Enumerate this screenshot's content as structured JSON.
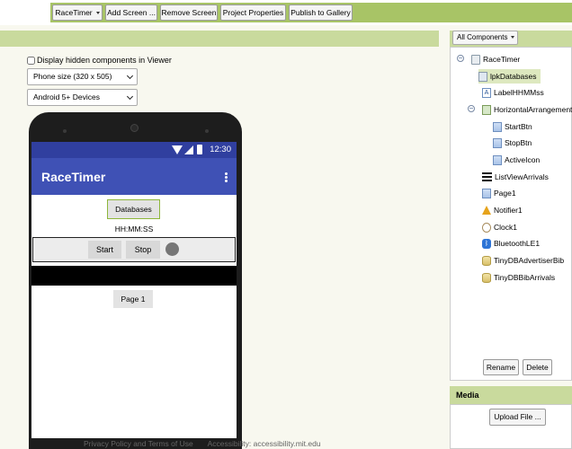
{
  "toolbar": {
    "project_label": "RaceTimer",
    "add_screen_label": "Add Screen ...",
    "remove_screen_label": "Remove Screen",
    "project_properties_label": "Project Properties",
    "publish_label": "Publish to Gallery"
  },
  "viewer": {
    "hidden_components_label": "Display hidden components in Viewer",
    "phone_size": "Phone size (320 x 505)",
    "device": "Android 5+ Devices"
  },
  "phone": {
    "time": "12:30",
    "app_title": "RaceTimer",
    "databases_button": "Databases",
    "time_label": "HH:MM:SS",
    "start_button": "Start",
    "stop_button": "Stop",
    "page_button": "Page 1"
  },
  "footer": {
    "privacy": "Privacy Policy and Terms of Use",
    "accessibility": "Accessibility: accessibility.mit.edu"
  },
  "components": {
    "filter_label": "All Components",
    "tree": [
      {
        "label": "RaceTimer",
        "icon": "screen-icon"
      },
      {
        "label": "lpkDatabases",
        "icon": "listpicker-icon",
        "selected": true
      },
      {
        "label": "LabelHHMMss",
        "icon": "label-icon"
      },
      {
        "label": "HorizontalArrangement1",
        "icon": "horizontal-arrangement-icon"
      },
      {
        "label": "StartBtn",
        "icon": "button-icon"
      },
      {
        "label": "StopBtn",
        "icon": "button-icon"
      },
      {
        "label": "ActiveIcon",
        "icon": "button-icon"
      },
      {
        "label": "ListViewArrivals",
        "icon": "listview-icon"
      },
      {
        "label": "Page1",
        "icon": "button-icon"
      },
      {
        "label": "Notifier1",
        "icon": "notifier-icon"
      },
      {
        "label": "Clock1",
        "icon": "clock-icon"
      },
      {
        "label": "BluetoothLE1",
        "icon": "bluetooth-icon"
      },
      {
        "label": "TinyDBAdvertiserBib",
        "icon": "tinydb-icon"
      },
      {
        "label": "TinyDBBibArrivals",
        "icon": "tinydb-icon"
      }
    ],
    "rename_label": "Rename",
    "delete_label": "Delete"
  },
  "media": {
    "header": "Media",
    "upload_label": "Upload File ..."
  }
}
